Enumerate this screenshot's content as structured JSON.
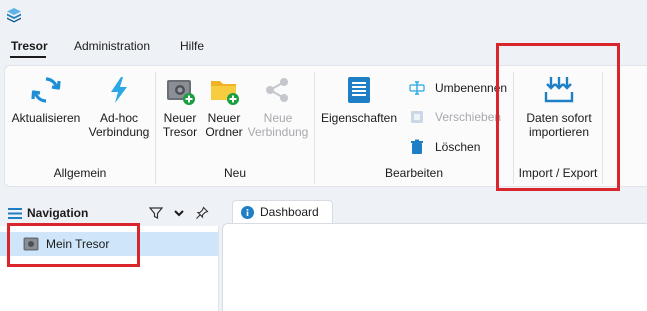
{
  "menubar": {
    "items": [
      {
        "label": "Tresor",
        "active": true
      },
      {
        "label": "Administration",
        "active": false
      },
      {
        "label": "Hilfe",
        "active": false
      }
    ]
  },
  "ribbon": {
    "groups": {
      "allgemein": {
        "label": "Allgemein",
        "buttons": {
          "refresh": "Aktualisieren",
          "adhoc_line1": "Ad-hoc",
          "adhoc_line2": "Verbindung"
        }
      },
      "neu": {
        "label": "Neu",
        "buttons": {
          "vault_line1": "Neuer",
          "vault_line2": "Tresor",
          "folder_line1": "Neuer",
          "folder_line2": "Ordner",
          "conn_line1": "Neue",
          "conn_line2": "Verbindung"
        }
      },
      "bearbeiten": {
        "label": "Bearbeiten",
        "buttons": {
          "properties": "Eigenschaften",
          "rename": "Umbenennen",
          "move": "Verschieben",
          "delete": "Löschen"
        }
      },
      "import_export": {
        "label": "Import / Export",
        "buttons": {
          "import_line1": "Daten sofort",
          "import_line2": "importieren"
        }
      }
    }
  },
  "navigation": {
    "title": "Navigation",
    "items": [
      {
        "label": "Mein Tresor",
        "selected": true
      }
    ]
  },
  "documents": {
    "tabs": [
      {
        "label": "Dashboard"
      }
    ]
  },
  "colors": {
    "accent": "#0f6cbd",
    "highlight": "#d9262d",
    "selection": "#cfe6fa"
  }
}
